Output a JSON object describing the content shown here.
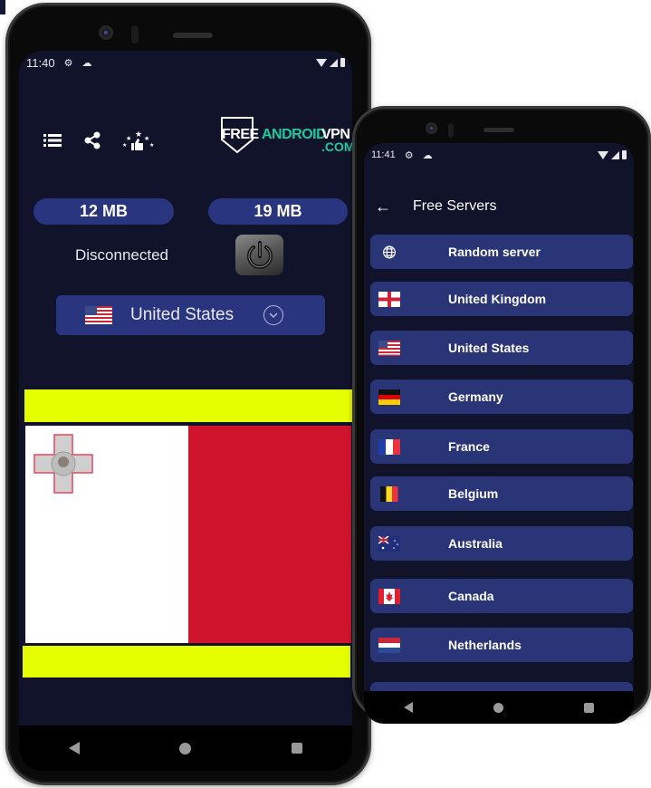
{
  "left_phone": {
    "status_bar": {
      "time": "11:40",
      "icons": [
        "gear-icon",
        "cloud-icon",
        "wifi-icon",
        "signal-icon",
        "battery-icon"
      ]
    },
    "toolbar": {
      "icons": [
        "menu-list-icon",
        "share-icon",
        "rate-stars-thumbs-up-icon"
      ]
    },
    "logo": {
      "part1": "FREE",
      "part2": "ANDROID",
      "part3": "VPN",
      "part4": ".COM"
    },
    "traffic": {
      "download": "12 MB",
      "upload": "19 MB"
    },
    "connection_status": "Disconnected",
    "power_button_icon": "power-icon",
    "selected_country": {
      "name": "United States",
      "flag": "us-flag"
    },
    "banner": {
      "flag": "malta-flag",
      "colors": {
        "yellow": "#e6ff00",
        "red": "#cf142b",
        "white": "#ffffff"
      }
    },
    "nav": [
      "back",
      "home",
      "recents"
    ]
  },
  "right_phone": {
    "status_bar": {
      "time": "11:41",
      "icons": [
        "gear-icon",
        "cloud-icon",
        "wifi-icon",
        "signal-icon",
        "battery-icon"
      ]
    },
    "appbar": {
      "back_icon": "arrow-left-icon",
      "title": "Free Servers"
    },
    "servers": [
      {
        "name": "Random server",
        "icon": "globe-icon"
      },
      {
        "name": "United Kingdom",
        "icon": "england-flag"
      },
      {
        "name": "United States",
        "icon": "us-flag"
      },
      {
        "name": "Germany",
        "icon": "germany-flag"
      },
      {
        "name": "France",
        "icon": "france-flag"
      },
      {
        "name": "Belgium",
        "icon": "belgium-flag"
      },
      {
        "name": "Australia",
        "icon": "australia-flag"
      },
      {
        "name": "Canada",
        "icon": "canada-flag"
      },
      {
        "name": "Netherlands",
        "icon": "netherlands-flag"
      }
    ],
    "nav": [
      "back",
      "home",
      "recents"
    ]
  },
  "theme": {
    "background": "#10132a",
    "card": "#2a3580",
    "accent_green": "#1ec9a0"
  }
}
